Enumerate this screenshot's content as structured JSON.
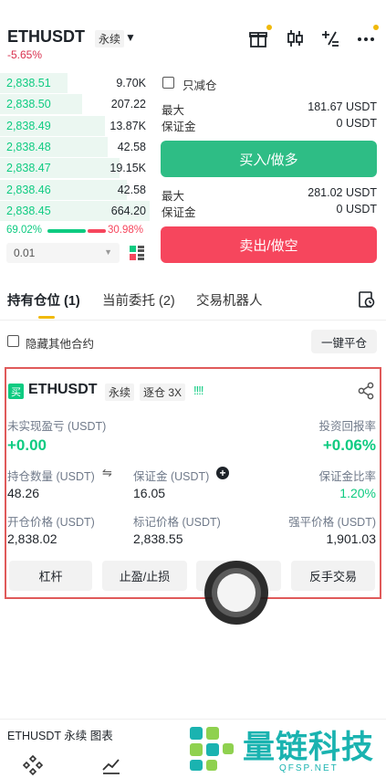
{
  "header": {
    "symbol": "ETHUSDT",
    "contract_type": "永续",
    "change": "-5.65%"
  },
  "icons": {
    "gift": "gift-icon",
    "candles": "candlestick-icon",
    "calculator": "calculator-icon",
    "more": "more-icon"
  },
  "order_book": {
    "rows": [
      {
        "price": "2,838.51",
        "qty": "9.70K",
        "depth": 0.45
      },
      {
        "price": "2,838.50",
        "qty": "207.22",
        "depth": 0.55
      },
      {
        "price": "2,838.49",
        "qty": "13.87K",
        "depth": 0.7
      },
      {
        "price": "2,838.48",
        "qty": "42.58",
        "depth": 0.72
      },
      {
        "price": "2,838.47",
        "qty": "19.15K",
        "depth": 0.8
      },
      {
        "price": "2,838.46",
        "qty": "42.58",
        "depth": 0.85
      },
      {
        "price": "2,838.45",
        "qty": "664.20",
        "depth": 1.0
      }
    ],
    "buy_ratio": "69.02%",
    "sell_ratio": "30.98%",
    "precision": "0.01"
  },
  "trade_panel": {
    "reduce_only": "只减仓",
    "max_label": "最大",
    "margin_label": "保证金",
    "buy_max": "181.67 USDT",
    "buy_margin": "0 USDT",
    "buy_button": "买入/做多",
    "sell_max": "281.02 USDT",
    "sell_margin": "0 USDT",
    "sell_button": "卖出/做空"
  },
  "tabs": {
    "positions": "持有仓位 (1)",
    "orders": "当前委托 (2)",
    "bots": "交易机器人"
  },
  "filter": {
    "hide_others": "隐藏其他合约",
    "close_all": "一键平仓"
  },
  "position": {
    "side_badge": "买",
    "symbol": "ETHUSDT",
    "type": "永续",
    "margin_mode": "逐仓 3X",
    "signal": "!!!!",
    "unrealized_pnl_label": "未实现盈亏 (USDT)",
    "unrealized_pnl": "+0.00",
    "roe_label": "投资回报率",
    "roe": "+0.06%",
    "size_label": "持仓数量 (USDT)",
    "size": "48.26",
    "margin_label": "保证金 (USDT)",
    "margin": "16.05",
    "margin_ratio_label": "保证金比率",
    "margin_ratio": "1.20%",
    "entry_label": "开仓价格 (USDT)",
    "entry": "2,838.02",
    "mark_label": "标记价格 (USDT)",
    "mark": "2,838.55",
    "liq_label": "强平价格 (USDT)",
    "liq": "1,901.03",
    "btn_leverage": "杠杆",
    "btn_tpsl": "止盈/止损",
    "btn_close": "",
    "btn_reverse": "反手交易"
  },
  "footer": {
    "chart_label": "ETHUSDT 永续  图表"
  },
  "watermark": {
    "text": "量链科技",
    "sub": "QFSP.NET"
  },
  "colors": {
    "green": "#0ecb81",
    "red": "#f6465d",
    "yellow": "#f0b90b",
    "frame": "#e05a5a"
  }
}
